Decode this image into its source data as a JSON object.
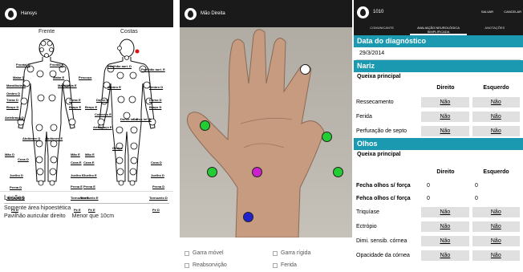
{
  "screen1": {
    "app_title": "Hansys",
    "views": [
      "Frente",
      "Costas"
    ],
    "front_points": [
      "Frontal D",
      "Frontal E",
      "Malar D",
      "Malar E",
      "Mandíbula D",
      "Mandíbula E",
      "Ombro D",
      "Tórax D",
      "Tórax E",
      "Braço D",
      "Braço E",
      "Antebraço D",
      "Abdômen D",
      "Abdômen E",
      "Mão D",
      "Mão E",
      "Coxa D",
      "Coxa E",
      "Joelho D",
      "Joelho E",
      "Perna D",
      "Perna E",
      "Tornozelo D",
      "Tornozelo E",
      "Pé D",
      "Pé E"
    ],
    "back_points": [
      "Pescoço",
      "Pavilhão auri. D",
      "Pavilhão auri. E",
      "Ombro E",
      "Ombro D",
      "Dorso E",
      "Dorso D",
      "Braço E",
      "Braço D",
      "Cotovelo E",
      "Antebraço E",
      "Dorso inf. E",
      "Dorso inf. D",
      "Glúteo",
      "Mão E",
      "Coxa E",
      "Coxa D",
      "Joelho E",
      "Joelho D",
      "Perna E",
      "Perna D",
      "Tornozelo E",
      "Tornozelo D",
      "Pé E",
      "Pé D"
    ],
    "lesions_title": "Lesões",
    "lesion1": "Somente área hipoestética",
    "lesion2_site": "Pavilhão auricular direito",
    "lesion2_size": "Menor que 10cm"
  },
  "screen2": {
    "app_title": "Mão Direita",
    "points": [
      {
        "name": "marker-white",
        "color": "#ffffff"
      },
      {
        "name": "marker-green-1",
        "color": "#22cc33"
      },
      {
        "name": "marker-green-2",
        "color": "#22cc33"
      },
      {
        "name": "marker-green-3",
        "color": "#22cc33"
      },
      {
        "name": "marker-green-4",
        "color": "#22cc33"
      },
      {
        "name": "marker-magenta",
        "color": "#cc22cc"
      },
      {
        "name": "marker-blue",
        "color": "#2222cc"
      }
    ],
    "options": [
      "Garra móvel",
      "Garra rígida",
      "Reabsorvição",
      "Ferida"
    ]
  },
  "screen3": {
    "app_title": "1010",
    "actions": [
      "SALVAR",
      "CANCELAR"
    ],
    "tabs": [
      "COMUNICANTE",
      "AVALIAÇÃO NEUROLÓGICA SIMPLIFICADA",
      "ANOTAÇÕES"
    ],
    "diag_title": "Data do diagnóstico",
    "diag_date": "29/3/2014",
    "nariz_title": "Nariz",
    "queixa_label": "Queixa principal",
    "col_right": "Direito",
    "col_left": "Esquerdo",
    "nariz_rows": [
      {
        "label": "Ressecamento",
        "d": "Não",
        "e": "Não"
      },
      {
        "label": "Ferida",
        "d": "Não",
        "e": "Não"
      },
      {
        "label": "Perfuração de septo",
        "d": "Não",
        "e": "Não"
      }
    ],
    "olhos_title": "Olhos",
    "olhos_num_rows": [
      {
        "label": "Fecha olhos s/ força",
        "d": "0",
        "e": "0"
      },
      {
        "label": "Fehca olhos c/ força",
        "d": "0",
        "e": "0"
      }
    ],
    "olhos_rows": [
      {
        "label": "Triquíase",
        "d": "Não",
        "e": "Não"
      },
      {
        "label": "Ectrópio",
        "d": "Não",
        "e": "Não"
      },
      {
        "label": "Dimi. sensib. córnea",
        "d": "Não",
        "e": "Não"
      },
      {
        "label": "Opacidade da córnea",
        "d": "Não",
        "e": "Não"
      }
    ]
  }
}
